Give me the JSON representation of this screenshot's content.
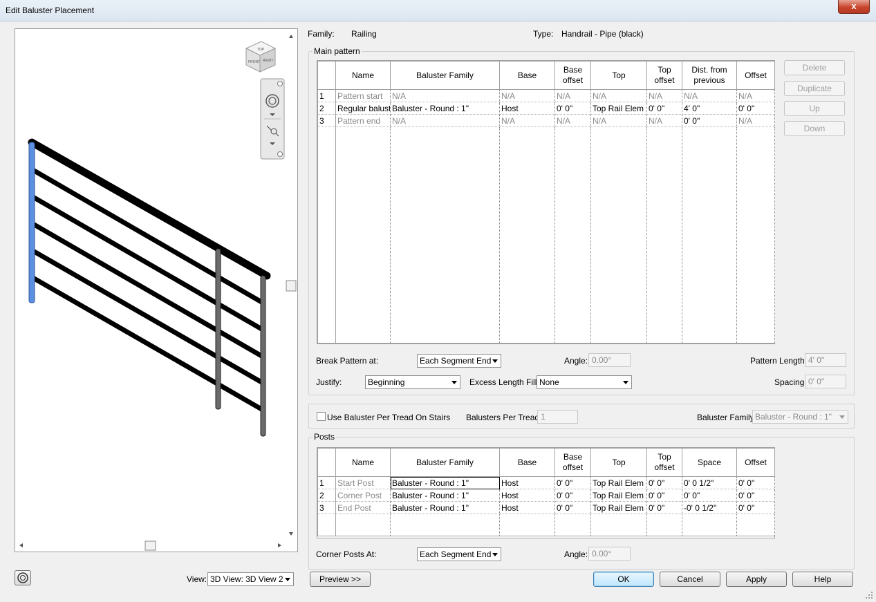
{
  "window": {
    "title": "Edit Baluster Placement",
    "close_symbol": "x"
  },
  "header": {
    "family_label": "Family:",
    "family_value": "Railing",
    "type_label": "Type:",
    "type_value": "Handrail - Pipe (black)"
  },
  "main_pattern": {
    "group_label": "Main pattern",
    "columns": [
      "Name",
      "Baluster Family",
      "Base",
      "Base offset",
      "Top",
      "Top offset",
      "Dist. from previous",
      "Offset"
    ],
    "rows": [
      {
        "idx": "1",
        "name": "Pattern start",
        "family": "N/A",
        "base": "N/A",
        "base_offset": "N/A",
        "top": "N/A",
        "top_offset": "N/A",
        "dist": "N/A",
        "offset": "N/A"
      },
      {
        "idx": "2",
        "name": "Regular balust",
        "family": "Baluster - Round : 1\"",
        "base": "Host",
        "base_offset": "0'  0\"",
        "top": "Top Rail Elem",
        "top_offset": "0'  0\"",
        "dist": "4'  0\"",
        "offset": "0'  0\""
      },
      {
        "idx": "3",
        "name": "Pattern end",
        "family": "N/A",
        "base": "N/A",
        "base_offset": "N/A",
        "top": "N/A",
        "top_offset": "N/A",
        "dist": "0'  0\"",
        "offset": "N/A"
      }
    ],
    "buttons": {
      "delete": "Delete",
      "duplicate": "Duplicate",
      "up": "Up",
      "down": "Down"
    },
    "break_label": "Break Pattern at:",
    "break_value": "Each Segment End",
    "angle_label": "Angle:",
    "angle_value": "0.00°",
    "pattern_length_label": "Pattern Length:",
    "pattern_length_value": "4'  0\"",
    "justify_label": "Justify:",
    "justify_value": "Beginning",
    "excess_label": "Excess Length Fill :",
    "excess_value": "None",
    "spacing_label": "Spacing:",
    "spacing_value": "0'  0\""
  },
  "stairs": {
    "checkbox_label": "Use Baluster Per Tread On Stairs",
    "per_tread_label": "Balusters Per Tread:",
    "per_tread_value": "1",
    "family_label": "Baluster Family:",
    "family_value": "Baluster - Round : 1\""
  },
  "posts": {
    "group_label": "Posts",
    "columns": [
      "Name",
      "Baluster Family",
      "Base",
      "Base offset",
      "Top",
      "Top offset",
      "Space",
      "Offset"
    ],
    "rows": [
      {
        "idx": "1",
        "name": "Start Post",
        "family": "Baluster - Round : 1\"",
        "base": "Host",
        "base_offset": "0'  0\"",
        "top": "Top Rail Elem",
        "top_offset": "0'  0\"",
        "space": "0'  0 1/2\"",
        "offset": "0'  0\""
      },
      {
        "idx": "2",
        "name": "Corner Post",
        "family": "Baluster - Round : 1\"",
        "base": "Host",
        "base_offset": "0'  0\"",
        "top": "Top Rail Elem",
        "top_offset": "0'  0\"",
        "space": "0'  0\"",
        "offset": "0'  0\""
      },
      {
        "idx": "3",
        "name": "End Post",
        "family": "Baluster - Round : 1\"",
        "base": "Host",
        "base_offset": "0'  0\"",
        "top": "Top Rail Elem",
        "top_offset": "0'  0\"",
        "space": "-0'  0 1/2\"",
        "offset": "0'  0\""
      }
    ],
    "corner_label": "Corner Posts At:",
    "corner_value": "Each Segment End",
    "angle_label": "Angle:",
    "angle_value": "0.00°"
  },
  "preview": {
    "view_label": "View:",
    "view_value": "3D View: 3D View 2",
    "cube_front": "FRONT",
    "cube_right": "RIGHT",
    "cube_top": "TOP"
  },
  "footer": {
    "preview_button": "Preview >>",
    "ok": "OK",
    "cancel": "Cancel",
    "apply": "Apply",
    "help": "Help"
  }
}
